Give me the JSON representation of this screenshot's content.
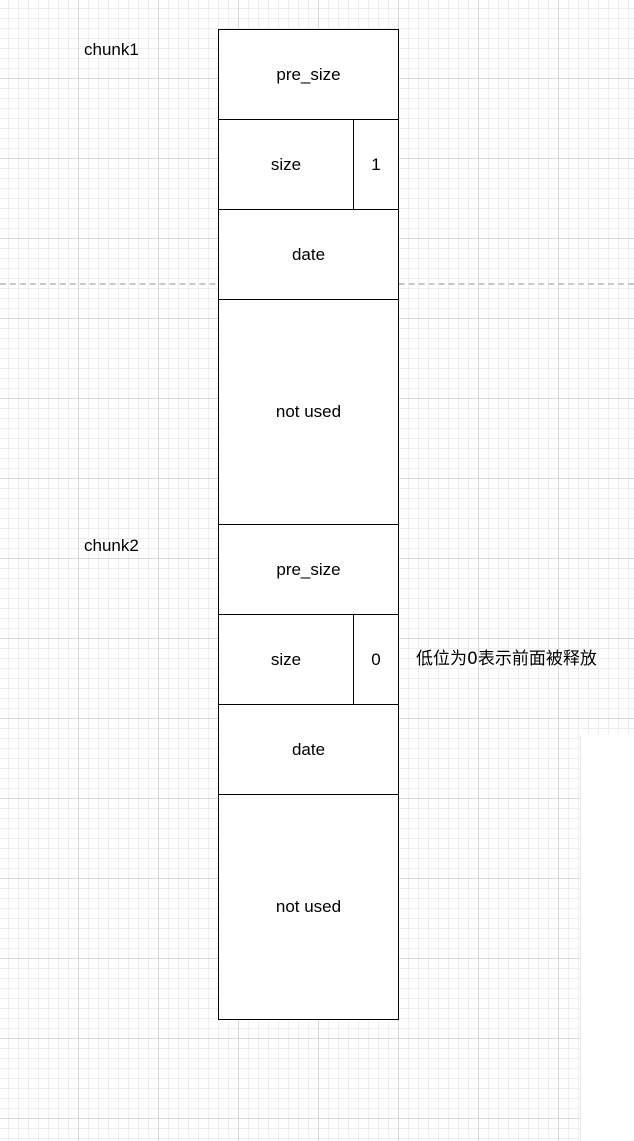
{
  "chunks": [
    {
      "label": "chunk1",
      "pre_size": "pre_size",
      "size": "size",
      "flag": "1",
      "data": "date",
      "unused": "not used"
    },
    {
      "label": "chunk2",
      "pre_size": "pre_size",
      "size": "size",
      "flag": "0",
      "data": "date",
      "unused": "not used"
    }
  ],
  "note": "低位为0表示前面被释放"
}
